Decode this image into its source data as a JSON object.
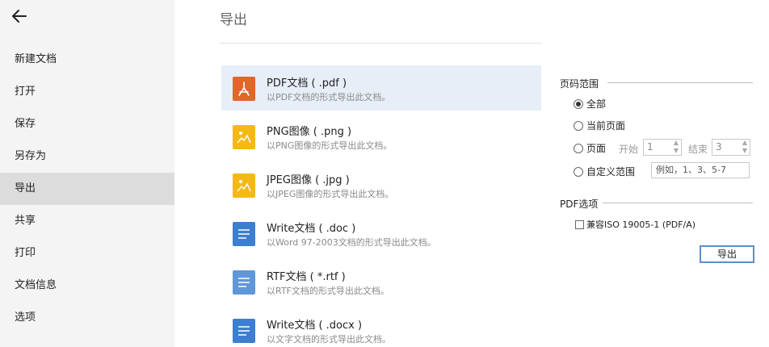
{
  "sidebar": {
    "items": [
      {
        "label": "新建文档"
      },
      {
        "label": "打开"
      },
      {
        "label": "保存"
      },
      {
        "label": "另存为"
      },
      {
        "label": "导出"
      },
      {
        "label": "共享"
      },
      {
        "label": "打印"
      },
      {
        "label": "文档信息"
      },
      {
        "label": "选项"
      }
    ],
    "active": "导出"
  },
  "main": {
    "title": "导出",
    "formats": [
      {
        "name": "PDF文档 ( .pdf )",
        "desc": "以PDF文档的形式导出此文档。",
        "icon": "pdf-icon",
        "color": "#e0662a"
      },
      {
        "name": "PNG图像 ( .png )",
        "desc": "以PNG图像的形式导出此文档。",
        "icon": "image-icon",
        "color": "#f5b916"
      },
      {
        "name": "JPEG图像 ( .jpg )",
        "desc": "以JPEG图像的形式导出此文档。",
        "icon": "image-icon",
        "color": "#f5b916"
      },
      {
        "name": "Write文档 ( .doc )",
        "desc": "以Word 97-2003文档的形式导出此文档。",
        "icon": "document-icon",
        "color": "#3c7fd0"
      },
      {
        "name": "RTF文档 ( *.rtf )",
        "desc": "以RTF文档的形式导出此文档。",
        "icon": "document-icon",
        "color": "#5f97d8"
      },
      {
        "name": "Write文档 ( .docx )",
        "desc": "以文字文档的形式导出此文档。",
        "icon": "document-icon",
        "color": "#3c7fd0"
      }
    ]
  },
  "options": {
    "page_range_label": "页码范围",
    "radio_all": "全部",
    "radio_current": "当前页面",
    "radio_pages": "页面",
    "start_label": "开始",
    "start_value": "1",
    "end_label": "结束",
    "end_value": "3",
    "radio_custom": "自定义范围",
    "custom_placeholder": "例如，1、3、5-7",
    "pdf_options_label": "PDF选项",
    "pdfa_checkbox": "兼容ISO 19005-1 (PDF/A)",
    "export_button": "导出"
  },
  "colors": {
    "sidebar_bg": "#f4f4f4",
    "active_nav": "#dcdcdc",
    "selected_item": "#e8eef8",
    "button_border": "#5a8fd0"
  }
}
